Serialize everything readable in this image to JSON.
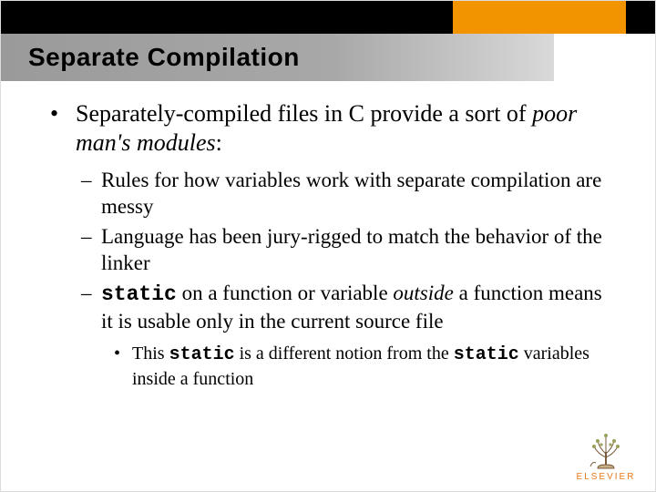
{
  "title": "Separate Compilation",
  "l1": {
    "prefix": "Separately-compiled files in C provide a sort of ",
    "em": "poor man's modules",
    "suffix": ":"
  },
  "l2a": "Rules for how variables work with separate compilation are messy",
  "l2b": "Language has been jury-rigged to match the behavior of the linker",
  "l2c": {
    "code1": "static",
    "mid1": " on a function or variable ",
    "em": "outside",
    "mid2": " a function means it is usable only in the current source file"
  },
  "l3": {
    "pre": "This ",
    "code1": "static",
    "mid": " is a different notion from the ",
    "code2": "static",
    "post": " variables inside a function"
  },
  "logo": "ELSEVIER"
}
